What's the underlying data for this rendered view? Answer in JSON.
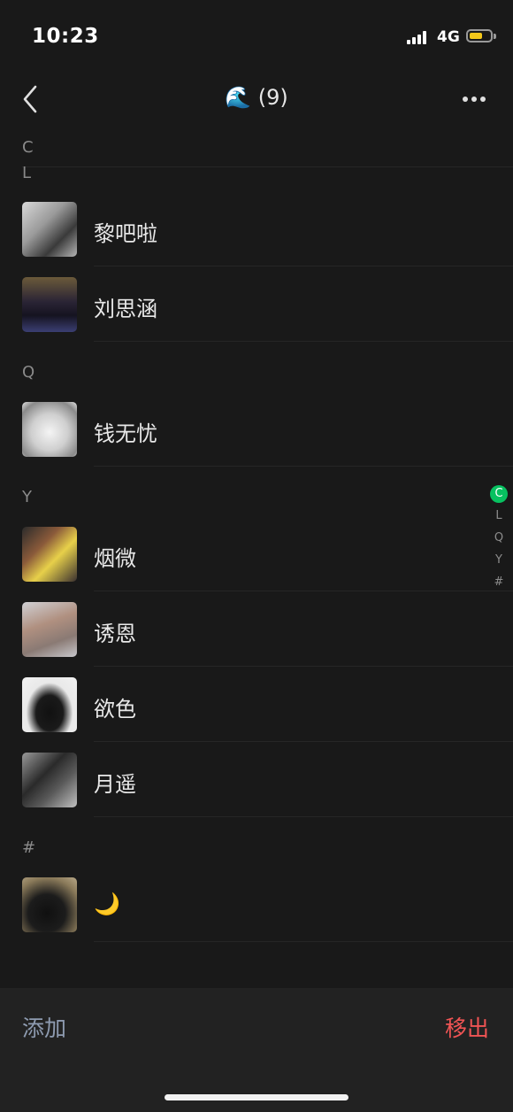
{
  "status": {
    "time": "10:23",
    "network": "4G"
  },
  "nav": {
    "title": "🌊 (9)",
    "back_icon": "chevron-left-icon",
    "more_icon": "ellipsis-icon"
  },
  "sections": [
    {
      "letter": "C",
      "members": []
    },
    {
      "letter": "L",
      "members": [
        {
          "name": "黎吧啦"
        },
        {
          "name": "刘思涵"
        }
      ]
    },
    {
      "letter": "Q",
      "members": [
        {
          "name": "钱无忧"
        }
      ]
    },
    {
      "letter": "Y",
      "members": [
        {
          "name": "烟微"
        },
        {
          "name": "诱恩"
        },
        {
          "name": "欲色"
        },
        {
          "name": "月遥"
        }
      ]
    },
    {
      "letter": "#",
      "members": [
        {
          "name": "🌙"
        }
      ]
    }
  ],
  "index": [
    "C",
    "L",
    "Q",
    "Y",
    "#"
  ],
  "index_active": "C",
  "bottom": {
    "add_label": "添加",
    "remove_label": "移出"
  },
  "colors": {
    "accent_green": "#07c160",
    "remove_red": "#f05454",
    "add_blue_grey": "#8e9bb0",
    "background": "#191919"
  }
}
